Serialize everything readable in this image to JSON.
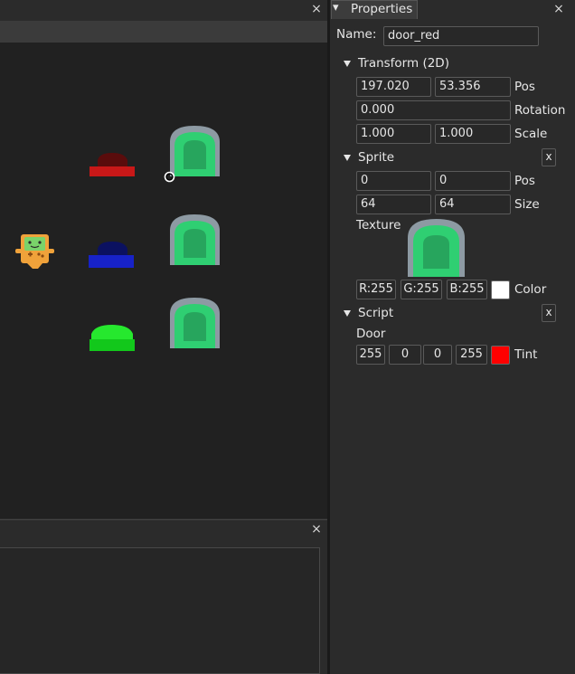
{
  "properties": {
    "panel_title": "Properties",
    "name_label": "Name:",
    "name_value": "door_red",
    "transform": {
      "header": "Transform (2D)",
      "pos_x": "197.020",
      "pos_y": "53.356",
      "pos_label": "Pos",
      "rotation": "0.000",
      "rotation_label": "Rotation",
      "scale_x": "1.000",
      "scale_y": "1.000",
      "scale_label": "Scale"
    },
    "sprite": {
      "header": "Sprite",
      "remove_label": "x",
      "pos_x": "0",
      "pos_y": "0",
      "pos_label": "Pos",
      "size_w": "64",
      "size_h": "64",
      "size_label": "Size",
      "texture_label": "Texture",
      "color_r": "R:255",
      "color_g": "G:255",
      "color_b": "B:255",
      "color_label": "Color",
      "color_hex": "#ffffff"
    },
    "script": {
      "header": "Script",
      "remove_label": "x",
      "script_name": "Door",
      "tint_r": "255",
      "tint_g": "0",
      "tint_b": "0",
      "tint_a": "255",
      "tint_label": "Tint",
      "tint_hex": "#ff0000"
    }
  },
  "icons": {
    "close": "×",
    "panel_menu": "▾"
  },
  "colors": {
    "door_frame": "#8d9aa3",
    "door_inner": "#2fcf72",
    "door_center": "#27a55d",
    "button_red": "#c81818",
    "button_red_dark": "#5a0c0c",
    "button_blue": "#1722c8",
    "button_blue_dark": "#0b1160",
    "button_green": "#12c81b",
    "button_green_light": "#26e82e"
  }
}
